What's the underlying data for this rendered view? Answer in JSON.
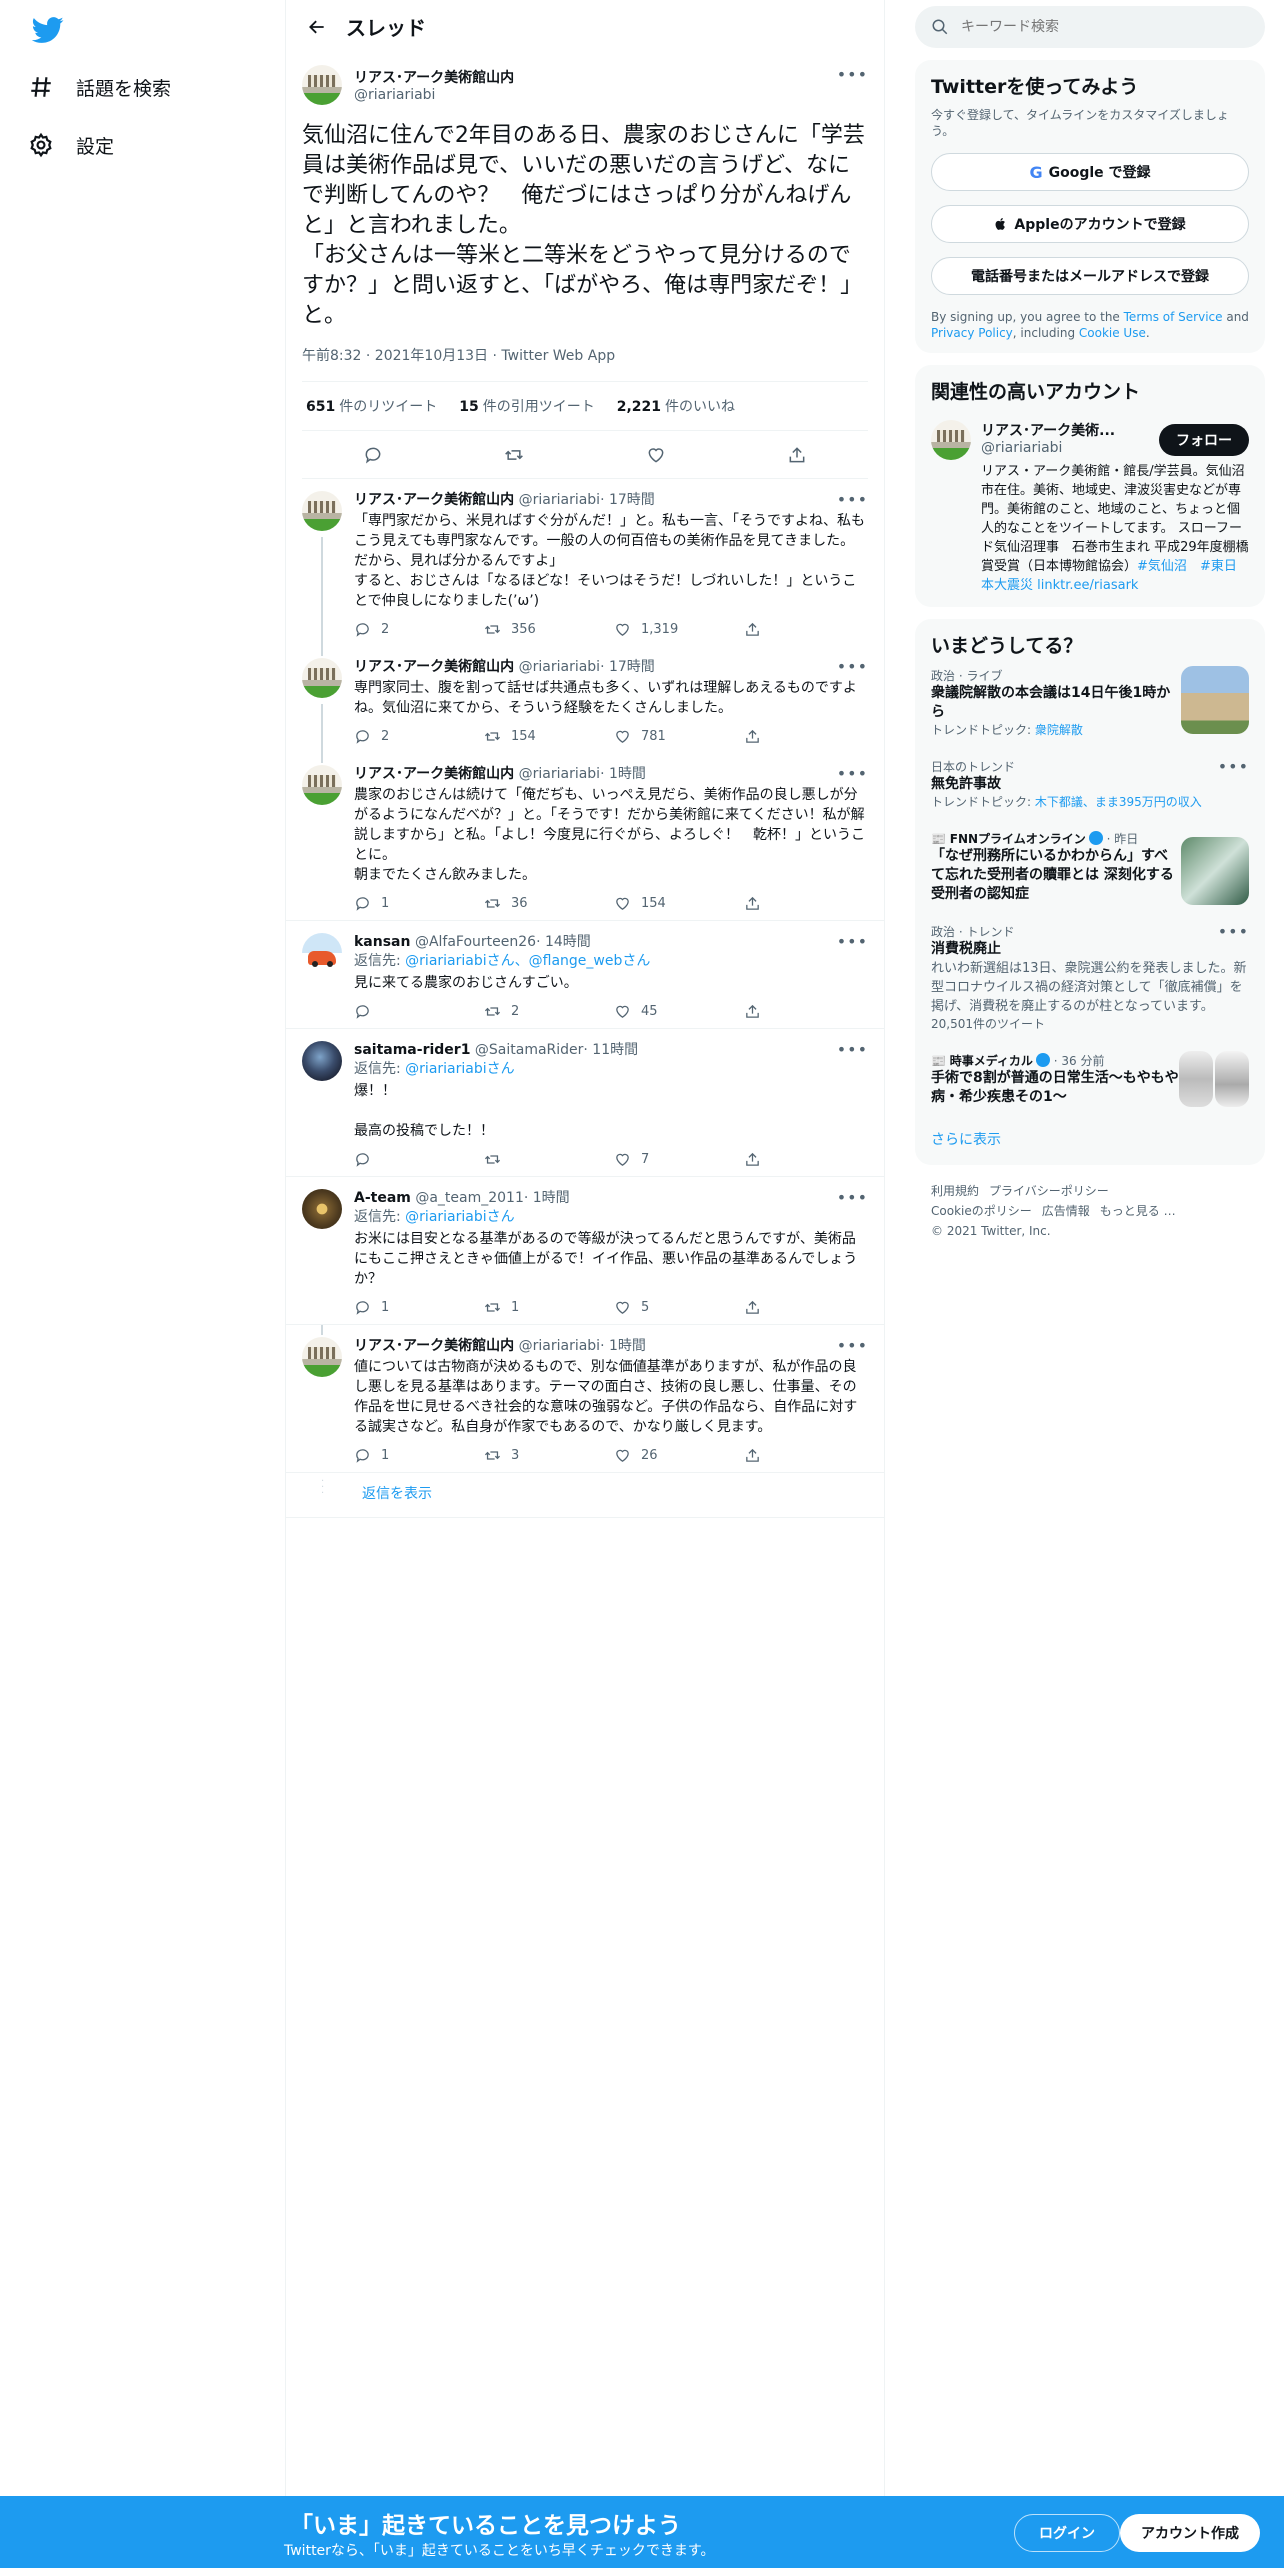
{
  "nav": {
    "explore_label": "話題を検索",
    "settings_label": "設定"
  },
  "header": {
    "title": "スレッド"
  },
  "main_tweet": {
    "name": "リアス･アーク美術館山内",
    "handle": "@riariariabi",
    "text": "気仙沼に住んで2年目のある日、農家のおじさんに「学芸員は美術作品ば見で、いいだの悪いだの言うげど、なにで判断してんのや？　俺だづにはさっぱり分がんねげんと」と言われました。\n「お父さんは一等米と二等米をどうやって見分けるのですか？」と問い返すと、「ばがやろ、俺は専門家だぞ！」と。",
    "meta": "午前8:32 · 2021年10月13日 · Twitter Web App",
    "retweets": "651",
    "retweets_label": "件のリツイート",
    "quotes": "15",
    "quotes_label": "件の引用ツイート",
    "likes": "2,221",
    "likes_label": "件のいいね"
  },
  "replies": [
    {
      "name": "リアス･アーク美術館山内",
      "handle": "@riariariabi",
      "time": "· 17時間",
      "reply_to": "",
      "text": "「専門家だから、米見ればすぐ分がんだ！」と。私も一言、「そうですよね、私もこう見えても専門家なんです。一般の人の何百倍もの美術作品を見てきました。だから、見れば分かるんですよ」\nすると、おじさんは「なるほどな！そいつはそうだ！しづれいした！」ということで仲良しになりました(’ω’)",
      "replies": "2",
      "retweets": "356",
      "likes": "1,319"
    },
    {
      "name": "リアス･アーク美術館山内",
      "handle": "@riariariabi",
      "time": "· 17時間",
      "reply_to": "",
      "text": "専門家同士、腹を割って話せば共通点も多く、いずれは理解しあえるものですよね。気仙沼に来てから、そういう経験をたくさんしました。",
      "replies": "2",
      "retweets": "154",
      "likes": "781"
    },
    {
      "name": "リアス･アーク美術館山内",
      "handle": "@riariariabi",
      "time": "· 1時間",
      "reply_to": "",
      "text": "農家のおじさんは続けて「俺だぢも、いっぺえ見だら、美術作品の良し悪しが分がるようになんだべが？」と。「そうです！だから美術館に来てください！私が解説しますから」と私。「よし！今度見に行ぐがら、よろしぐ！　乾杯！」ということに。\n朝までたくさん飲みました。",
      "replies": "1",
      "retweets": "36",
      "likes": "154"
    },
    {
      "name": "kansan",
      "handle": "@AlfaFourteen26",
      "time": "· 14時間",
      "reply_to_prefix": "返信先: ",
      "reply_to": "@riariariabiさん、@flange_webさん",
      "text": "見に来てる農家のおじさんすごい。",
      "replies": "",
      "retweets": "2",
      "likes": "45"
    },
    {
      "name": "saitama-rider1",
      "handle": "@SaitamaRider",
      "time": "· 11時間",
      "reply_to_prefix": "返信先: ",
      "reply_to": "@riariariabiさん",
      "text": "爆！！\n\n最高の投稿でした！！",
      "replies": "",
      "retweets": "",
      "likes": "7"
    },
    {
      "name": "A-team",
      "handle": "@a_team_2011",
      "time": "· 1時間",
      "reply_to_prefix": "返信先: ",
      "reply_to": "@riariariabiさん",
      "text": "お米には目安となる基準があるので等級が決ってるんだと思うんですが、美術品にもここ押さえときゃ価値上がるで！イイ作品、悪い作品の基準あるんでしょうか？",
      "replies": "1",
      "retweets": "1",
      "likes": "5"
    },
    {
      "name": "リアス･アーク美術館山内",
      "handle": "@riariariabi",
      "time": "· 1時間",
      "reply_to": "",
      "text": "値については古物商が決めるもので、別な価値基準がありますが、私が作品の良し悪しを見る基準はあります。テーマの面白さ、技術の良し悪し、仕事量、その作品を世に見せるべき社会的な意味の強弱など。子供の作品なら、自作品に対する誠実さなど。私自身が作家でもあるので、かなり厳しく見ます。",
      "replies": "1",
      "retweets": "3",
      "likes": "26"
    }
  ],
  "show_replies_label": "返信を表示",
  "search": {
    "placeholder": "キーワード検索"
  },
  "signup": {
    "title": "Twitterを使ってみよう",
    "subtitle": "今すぐ登録して、タイムラインをカスタマイズしましょう。",
    "google": "Google で登録",
    "apple": "Appleのアカウントで登録",
    "phone": "電話番号またはメールアドレスで登録",
    "fine_prefix": "By signing up, you agree to the ",
    "tos": "Terms of Service",
    "fine_and": " and ",
    "privacy": "Privacy Policy",
    "fine_including": ", including ",
    "cookie": "Cookie Use",
    "fine_end": "."
  },
  "related": {
    "title": "関連性の高いアカウント",
    "name": "リアス･アーク美術...",
    "handle": "@riariariabi",
    "follow_label": "フォロー",
    "bio": "リアス・アーク美術館・館長/学芸員。気仙沼市在住。美術、地域史、津波災害史などが専門。美術館のこと、地域のこと、ちょっと個人的なことをツイートしてます。 スローフード気仙沼理事　石巻市生まれ 平成29年度棚橋賞受賞（日本博物館協会）",
    "tag1": "#気仙沼",
    "tag2": "#東日本大震災",
    "link": "linktr.ee/riasark"
  },
  "trends": {
    "title": "いまどうしてる？",
    "items": [
      {
        "context": "政治 · ライブ",
        "title": "衆議院解散の本会議は14日午後1時から",
        "sub_prefix": "トレンドトピック: ",
        "sub_link": "衆院解散",
        "desc": ""
      },
      {
        "context": "日本のトレンド",
        "title": "無免許事故",
        "sub_prefix": "トレンドトピック: ",
        "sub_link": "木下都議、まま395万円の収入",
        "desc": ""
      },
      {
        "context": "FNNプライムオンライン",
        "context_time": " · 昨日",
        "title": "「なぜ刑務所にいるかわからん」すべて忘れた受刑者の贖罪とは 深刻化する受刑者の認知症",
        "sub_prefix": "",
        "sub_link": "",
        "desc": ""
      },
      {
        "context": "政治 · トレンド",
        "title": "消費税廃止",
        "sub_prefix": "",
        "sub_link": "",
        "desc": "れいわ新選組は13日、衆院選公約を発表しました。新型コロナウイルス禍の経済対策として「徹底補償」を掲げ、消費税を廃止するのが柱となっています。",
        "count": "20,501件のツイート"
      },
      {
        "context": "時事メディカル",
        "context_time": " · 36 分前",
        "title": "手術で8割が普通の日常生活～もやもや病・希少疾患その1～",
        "sub_prefix": "",
        "sub_link": "",
        "desc": ""
      }
    ],
    "show_more": "さらに表示"
  },
  "footer": {
    "links": [
      "利用規約",
      "プライバシーポリシー",
      "Cookieのポリシー",
      "広告情報",
      "もっと見る …"
    ],
    "copyright": "© 2021 Twitter, Inc."
  },
  "banner": {
    "headline": "「いま」起きていることを見つけよう",
    "sub": "Twitterなら、「いま」起きていることをいち早くチェックできます。",
    "login": "ログイン",
    "create": "アカウント作成"
  },
  "colors": {
    "brand": "#1d9bf0",
    "text": "#0f1419",
    "muted": "#536471"
  }
}
